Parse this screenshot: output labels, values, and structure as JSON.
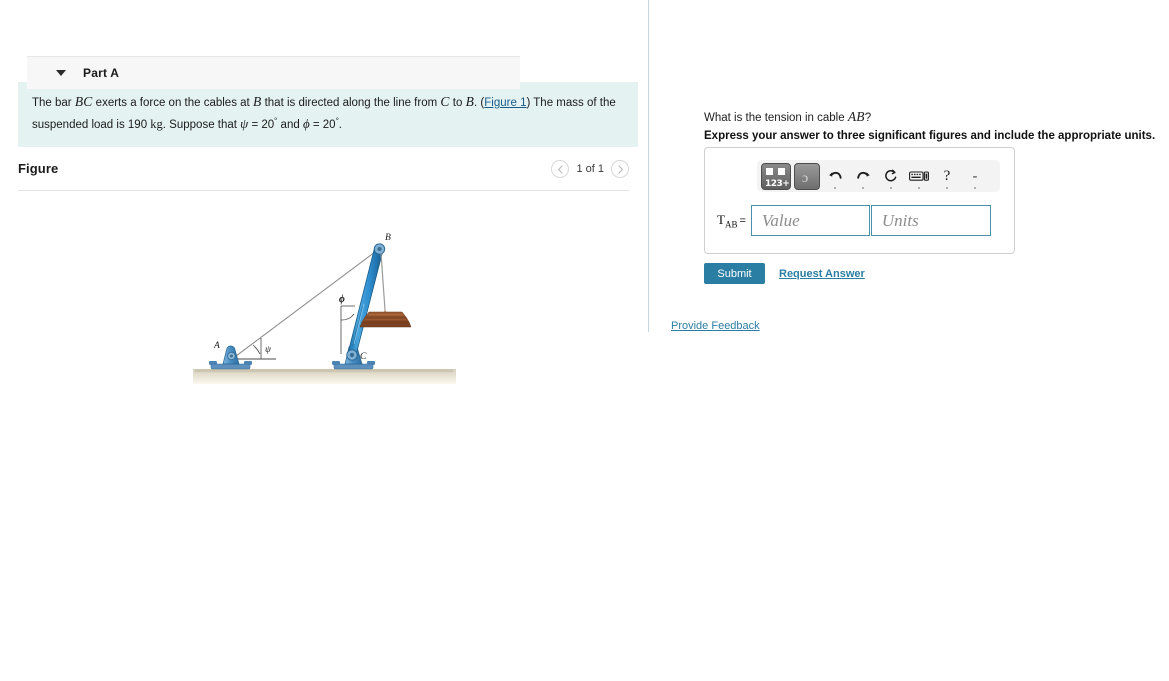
{
  "problem": {
    "text_part1": "The bar ",
    "var_bc": "BC",
    "text_part2": " exerts a force on the cables at ",
    "var_b": "B",
    "text_part3": " that is directed along the line from ",
    "var_c": "C",
    "text_part4": " to ",
    "var_b2": "B",
    "text_part5": ". (",
    "figure_link": "Figure 1",
    "text_part6": ") The mass of the suspended load is 190 ",
    "unit_kg": "kg",
    "text_part7": ". Suppose that ",
    "psi_symbol": "ψ",
    "psi_eq": " = 20",
    "deg1": "°",
    "text_and": " and ",
    "phi_symbol": "ϕ",
    "phi_eq": " = 20",
    "deg2": "°",
    "text_end": "."
  },
  "figure": {
    "title": "Figure",
    "page_indicator": "1 of 1",
    "prev_label": "‹",
    "next_label": "›",
    "labels": {
      "point_a": "A",
      "point_b": "B",
      "point_c": "C",
      "angle_psi": "ψ",
      "angle_phi": "ϕ"
    },
    "colors": {
      "bar_blue": "#2f8fd0",
      "bar_blue_dark": "#1b6ea8",
      "support_blue": "#4a8fc4",
      "ground": "#d8d2c0",
      "load_brown": "#8a4a2a",
      "cable_gray": "#8a8a8a",
      "background": "#ffffff"
    }
  },
  "part_a": {
    "header_label": "Part A",
    "caret": "chevron-down",
    "question": "What is the tension in cable ",
    "question_var": "AB",
    "question_end": "?",
    "instruction": "Express your answer to three significant figures and include the appropriate units.",
    "answer_label": "T",
    "answer_label_sub": "AB",
    "equals": "=",
    "value_placeholder": "Value",
    "units_placeholder": "Units",
    "value_current": "",
    "units_current": "",
    "toolbar": {
      "template_key": "123+",
      "sqrt_key": "ɔ",
      "undo": "undo-arrow",
      "redo": "redo-arrow",
      "reset": "reset-circular-arrow",
      "keyboard": "keyboard-icon",
      "help": "?",
      "minus": "-"
    },
    "submit_label": "Submit",
    "request_answer_label": "Request Answer"
  },
  "footer": {
    "provide_feedback_label": "Provide Feedback"
  },
  "theme": {
    "accent_blue": "#2b7ea3",
    "problem_panel_bg": "#e4f2f2",
    "part_header_bg": "#f7f7f7",
    "input_border": "#4a90ab",
    "divider": "#c8d4de"
  }
}
